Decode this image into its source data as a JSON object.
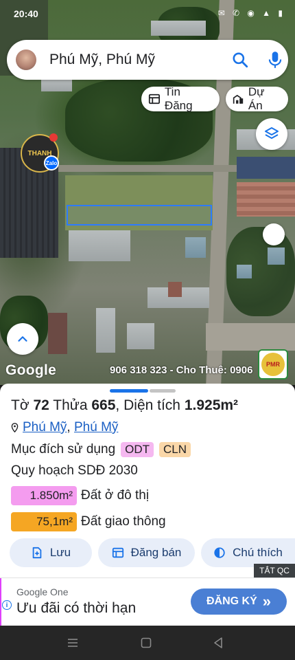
{
  "status_bar": {
    "time": "20:40",
    "icons": "✉ ✆ ◉ ▲ ▮"
  },
  "search": {
    "query": "Phú Mỹ, Phú Mỹ"
  },
  "chips": {
    "listings": "Tin Đăng",
    "projects": "Dự Án"
  },
  "map": {
    "attribution": "Google",
    "watermark": "906 318 323 - Cho Thuê: 0906",
    "badge_text": "THANH",
    "zalo_text": "Zalo",
    "pmr_text": "PMR"
  },
  "sheet": {
    "title_prefix": "Tờ",
    "sheet_no": "72",
    "parcel_label": "Thửa",
    "parcel_no": "665",
    "area_label": "Diện tích",
    "area_value": "1.925m²",
    "location_ward": "Phú Mỹ",
    "location_sep": ",",
    "location_district": "Phú Mỹ",
    "purpose_label": "Mục đích sử dụng",
    "purpose_tags": [
      {
        "label": "ODT",
        "color": "#f5b8f0"
      },
      {
        "label": "CLN",
        "color": "#fad7a8"
      }
    ],
    "plan_label": "Quy hoạch SDĐ 2030",
    "zones": [
      {
        "area": "1.850m²",
        "name": "Đất ở đô thị",
        "color": "#f49cef"
      },
      {
        "area": "75,1m²",
        "name": "Đất giao thông",
        "color": "#f5a623"
      }
    ]
  },
  "actions": {
    "save": "Lưu",
    "post_sale": "Đăng bán",
    "note": "Chú thích"
  },
  "ad": {
    "toggle": "TẮT QC",
    "sponsor": "Google One",
    "headline": "Ưu đãi có thời hạn",
    "cta": "ĐĂNG KÝ",
    "cta_arrow": "»"
  },
  "colors": {
    "accent_blue": "#1a73e8",
    "parcel_outline": "#2d7bff",
    "button_bg": "#e8eef9"
  }
}
